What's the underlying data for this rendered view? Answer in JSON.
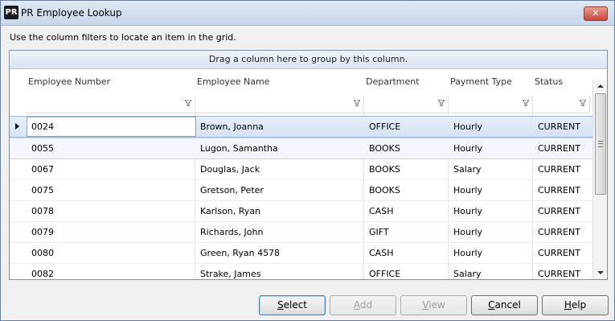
{
  "window": {
    "app_icon": "PR",
    "title": "PR Employee Lookup",
    "close_label": "✕"
  },
  "instructions": "Use the column filters to locate an item in the grid.",
  "grid": {
    "group_hint": "Drag a column here to group by this column.",
    "columns": [
      "Employee Number",
      "Employee Name",
      "Department",
      "Payment Type",
      "Status"
    ],
    "rows": [
      [
        "0024",
        "Brown, Joanna",
        "OFFICE",
        "Hourly",
        "CURRENT"
      ],
      [
        "0055",
        "Lugon, Samantha",
        "BOOKS",
        "Hourly",
        "CURRENT"
      ],
      [
        "0067",
        "Douglas, Jack",
        "BOOKS",
        "Salary",
        "CURRENT"
      ],
      [
        "0075",
        "Gretson, Peter",
        "BOOKS",
        "Hourly",
        "CURRENT"
      ],
      [
        "0078",
        "Karlson, Ryan",
        "CASH",
        "Hourly",
        "CURRENT"
      ],
      [
        "0079",
        "Richards, John",
        "GIFT",
        "Hourly",
        "CURRENT"
      ],
      [
        "0080",
        "Green, Ryan 4578",
        "CASH",
        "Hourly",
        "CURRENT"
      ],
      [
        "0082",
        "Strake, James",
        "OFFICE",
        "Salary",
        "CURRENT"
      ]
    ]
  },
  "buttons": {
    "select": {
      "pre": "",
      "key": "S",
      "post": "elect"
    },
    "add": {
      "pre": "",
      "key": "A",
      "post": "dd"
    },
    "view": {
      "pre": "",
      "key": "V",
      "post": "iew"
    },
    "cancel": {
      "pre": "",
      "key": "C",
      "post": "ancel"
    },
    "help": {
      "pre": "",
      "key": "H",
      "post": "elp"
    }
  },
  "icons": {
    "filter": "filter-funnel-icon",
    "row_pointer": "row-indicator-arrow-icon"
  }
}
